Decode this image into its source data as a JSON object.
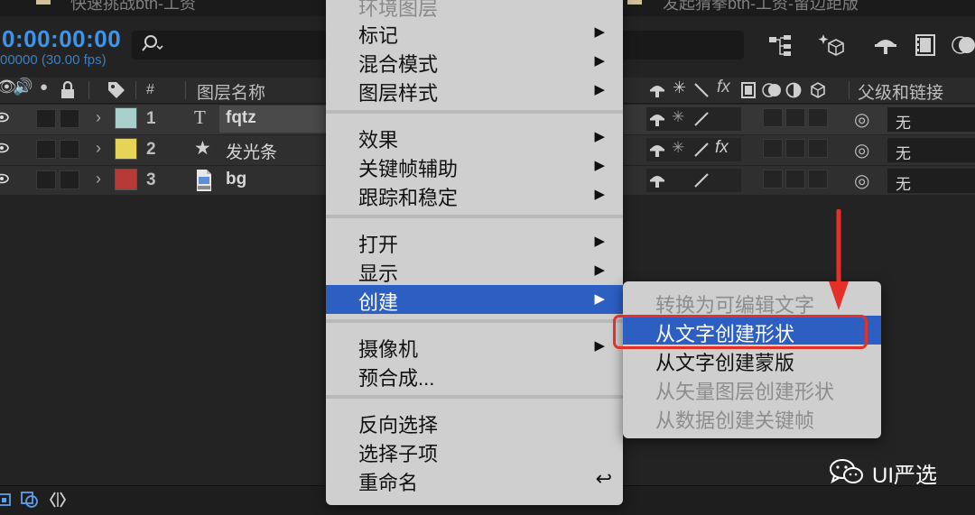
{
  "tabs": [
    {
      "label": "快速挑战bth-工资"
    },
    {
      "label": "发起猜拳bth-工资-留边距版"
    }
  ],
  "timeline": {
    "timecode": "0:00:00:00",
    "fps_text": "00000 (30.00 fps)",
    "search_placeholder": ""
  },
  "header": {
    "col_hash": "#",
    "col_layer_name": "图层名称",
    "col_switches_fx": "fx",
    "col_parent": "父级和链接"
  },
  "layers": [
    {
      "index": "1",
      "name": "fqtz",
      "type_icon": "T",
      "label_color": "#a9cfcb",
      "parent": "无"
    },
    {
      "index": "2",
      "name": "发光条",
      "type_icon": "★",
      "label_color": "#e6d458",
      "parent": "无"
    },
    {
      "index": "3",
      "name": "bg",
      "type_icon": "file",
      "label_color": "#b63b36",
      "parent": "无"
    }
  ],
  "row2_fx": "fx",
  "context_menu": {
    "items": [
      {
        "label": "环境图层",
        "disabled": true
      },
      {
        "label": "标记",
        "submenu": true
      },
      {
        "label": "混合模式",
        "submenu": true
      },
      {
        "label": "图层样式",
        "submenu": true
      },
      {
        "label": "效果",
        "submenu": true
      },
      {
        "label": "关键帧辅助",
        "submenu": true
      },
      {
        "label": "跟踪和稳定",
        "submenu": true
      },
      {
        "label": "打开",
        "submenu": true
      },
      {
        "label": "显示",
        "submenu": true
      },
      {
        "label": "创建",
        "submenu": true,
        "highlighted": true
      },
      {
        "label": "摄像机",
        "submenu": true
      },
      {
        "label": "预合成..."
      },
      {
        "label": "反向选择"
      },
      {
        "label": "选择子项"
      },
      {
        "label": "重命名",
        "shortcut": "↩"
      }
    ]
  },
  "submenu": {
    "items": [
      {
        "label": "转换为可编辑文字",
        "disabled": true
      },
      {
        "label": "从文字创建形状",
        "highlighted": true
      },
      {
        "label": "从文字创建蒙版"
      },
      {
        "label": "从矢量图层创建形状",
        "disabled": true
      },
      {
        "label": "从数据创建关键帧",
        "disabled": true
      }
    ]
  },
  "watermark": {
    "text": "UI严选"
  },
  "colors": {
    "highlight": "#2d5fc3",
    "annotation_red": "#e3312a",
    "timecode_blue": "#3d95ea"
  }
}
